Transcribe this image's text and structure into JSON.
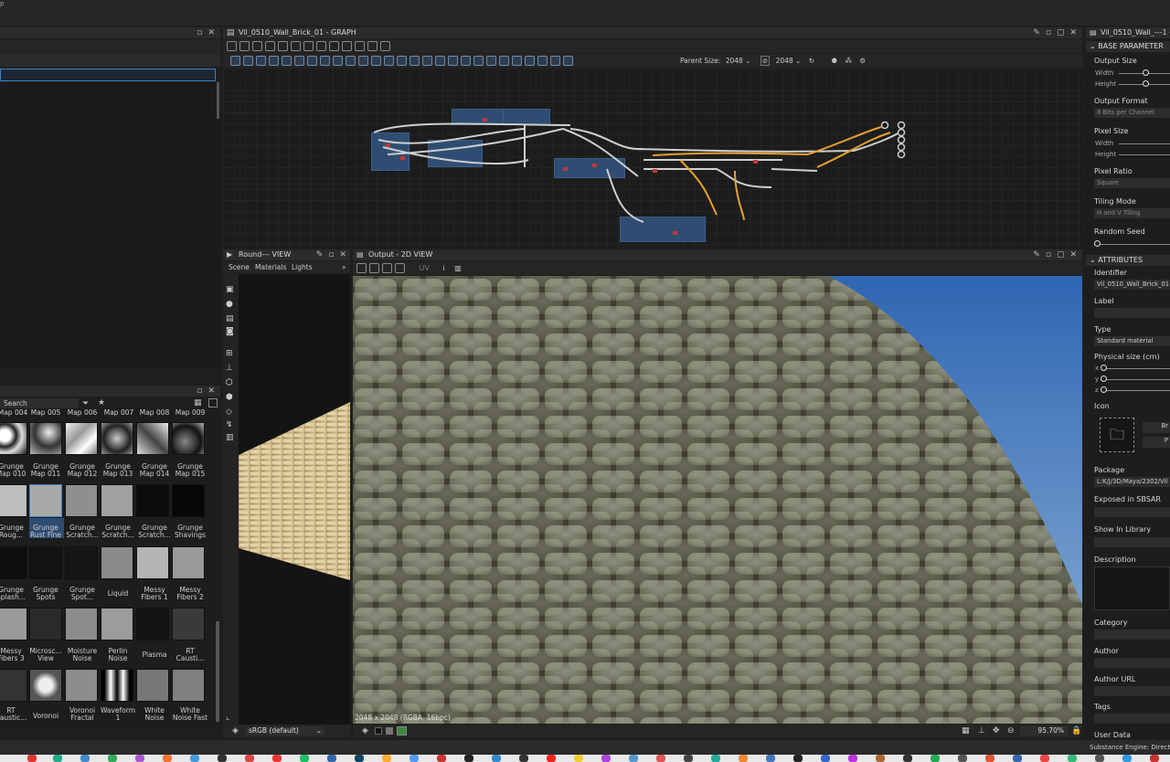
{
  "graph_panel": {
    "title": "Vil_0510_Wall_Brick_01 - GRAPH",
    "parent_size_label": "Parent Size:",
    "parent_size_value": "2048",
    "size_value": "2048"
  },
  "view3d_panel": {
    "title": "Round--- VIEW",
    "tabs": [
      "Scene",
      "Materials",
      "Lights"
    ]
  },
  "view2d_panel": {
    "title": "Output - 2D VIEW",
    "toolbar_uv": "UV",
    "status_text": "2048 x 2048 (RGBA, 16bpc)",
    "zoom": "95.70%"
  },
  "colorspace": "sRGB (default)",
  "library": {
    "search_placeholder": "Search",
    "row0_labels": [
      "Map 004",
      "Map 005",
      "Map 006",
      "Map 007",
      "Map 008",
      "Map 009"
    ],
    "items": [
      [
        "Grunge Map 010",
        "Grunge Map 011",
        "Grunge Map 012",
        "Grunge Map 013",
        "Grunge Map 014",
        "Grunge Map 015"
      ],
      [
        "Grunge Roug...",
        "Grunge Rust Fine",
        "Grunge Scratch...",
        "Grunge Scratch...",
        "Grunge Scratch...",
        "Grunge Shavings"
      ],
      [
        "Grunge Splash...",
        "Grunge Spots",
        "Grunge Spot...",
        "Liquid",
        "Messy Fibers 1",
        "Messy Fibers 2"
      ],
      [
        "Messy Fibers 3",
        "Microsc... View",
        "Moisture Noise",
        "Perlin Noise",
        "Plasma",
        "RT Causti..."
      ],
      [
        "RT Caustic...",
        "Voronoi",
        "Voronoi Fractal",
        "Waveform 1",
        "White Noise",
        "White Noise Fast"
      ]
    ]
  },
  "properties": {
    "title": "Vil_0510_Wall_---1 -",
    "section_base": "BASE PARAMETER",
    "output_size": "Output Size",
    "width": "Width",
    "height": "Height",
    "output_format": "Output Format",
    "output_format_value": "8 Bits per Channel",
    "pixel_size": "Pixel Size",
    "pixel_ratio": "Pixel Ratio",
    "pixel_ratio_value": "Square",
    "tiling_mode": "Tiling Mode",
    "tiling_mode_value": "H and V Tiling",
    "random_seed": "Random Seed",
    "section_attributes": "ATTRIBUTES",
    "identifier": "Identifier",
    "identifier_value": "Vil_0510_Wall_Brick_01",
    "label": "Label",
    "type": "Type",
    "type_value": "Standard material",
    "physical_size": "Physical size (cm)",
    "x": "x",
    "y": "y",
    "z": "z",
    "icon": "Icon",
    "icon_btn1": "Br",
    "icon_btn2": "P",
    "package": "Package",
    "package_value": "L:K/J/3D/Maya/2302/Vil",
    "exposed": "Exposed in SBSAR",
    "show_in_library": "Show In Library",
    "description": "Description",
    "category": "Category",
    "author": "Author",
    "author_url": "Author URL",
    "tags": "Tags",
    "user_data": "User Data"
  },
  "engine_status": "Substance Engine: Direct",
  "colors": {
    "accent": "#2f4d72",
    "wire_orange": "#e8a12c",
    "wire_grey": "#cfcfcf"
  }
}
